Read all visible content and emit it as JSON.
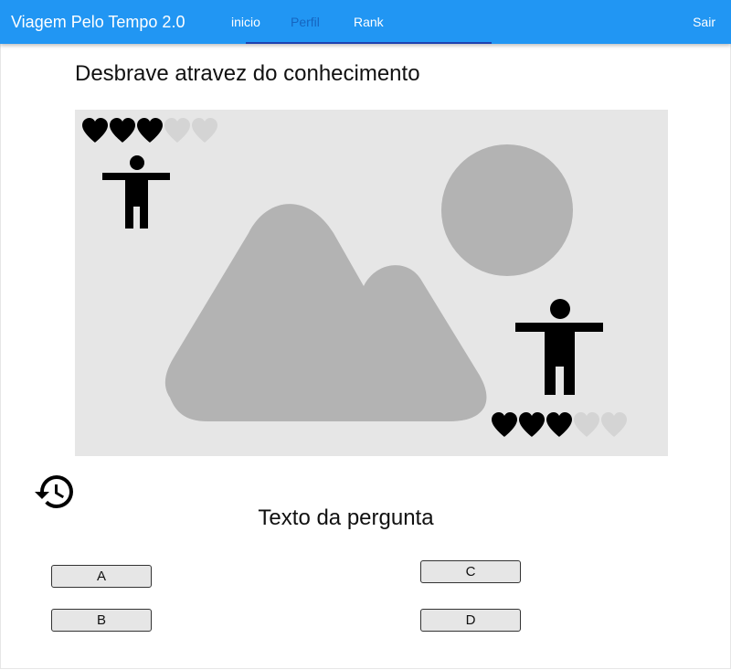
{
  "header": {
    "brand": "Viagem Pelo Tempo 2.0",
    "nav": [
      {
        "label": "inicio",
        "active": false
      },
      {
        "label": "Perfil",
        "active": true
      },
      {
        "label": "Rank",
        "active": false
      }
    ],
    "logout_label": "Sair"
  },
  "colors": {
    "appbar": "#2196f3",
    "active_tab_text": "#1565c0",
    "scene_bg": "#e6e6e6",
    "placeholder_shapes": "#b3b3b3",
    "heart_full": "#000000",
    "heart_empty": "#d4d4d4"
  },
  "main": {
    "heading": "Desbrave atravez do conhecimento",
    "scene": {
      "image_placeholder_icon": "landscape-placeholder-icon",
      "player": {
        "icon": "person-icon",
        "hearts_full": 3,
        "hearts_total": 5
      },
      "opponent": {
        "icon": "person-icon",
        "hearts_full": 3,
        "hearts_total": 5
      }
    },
    "history_icon": "history-icon",
    "question": "Texto da pergunta",
    "answers": {
      "a": "A",
      "b": "B",
      "c": "C",
      "d": "D"
    }
  }
}
